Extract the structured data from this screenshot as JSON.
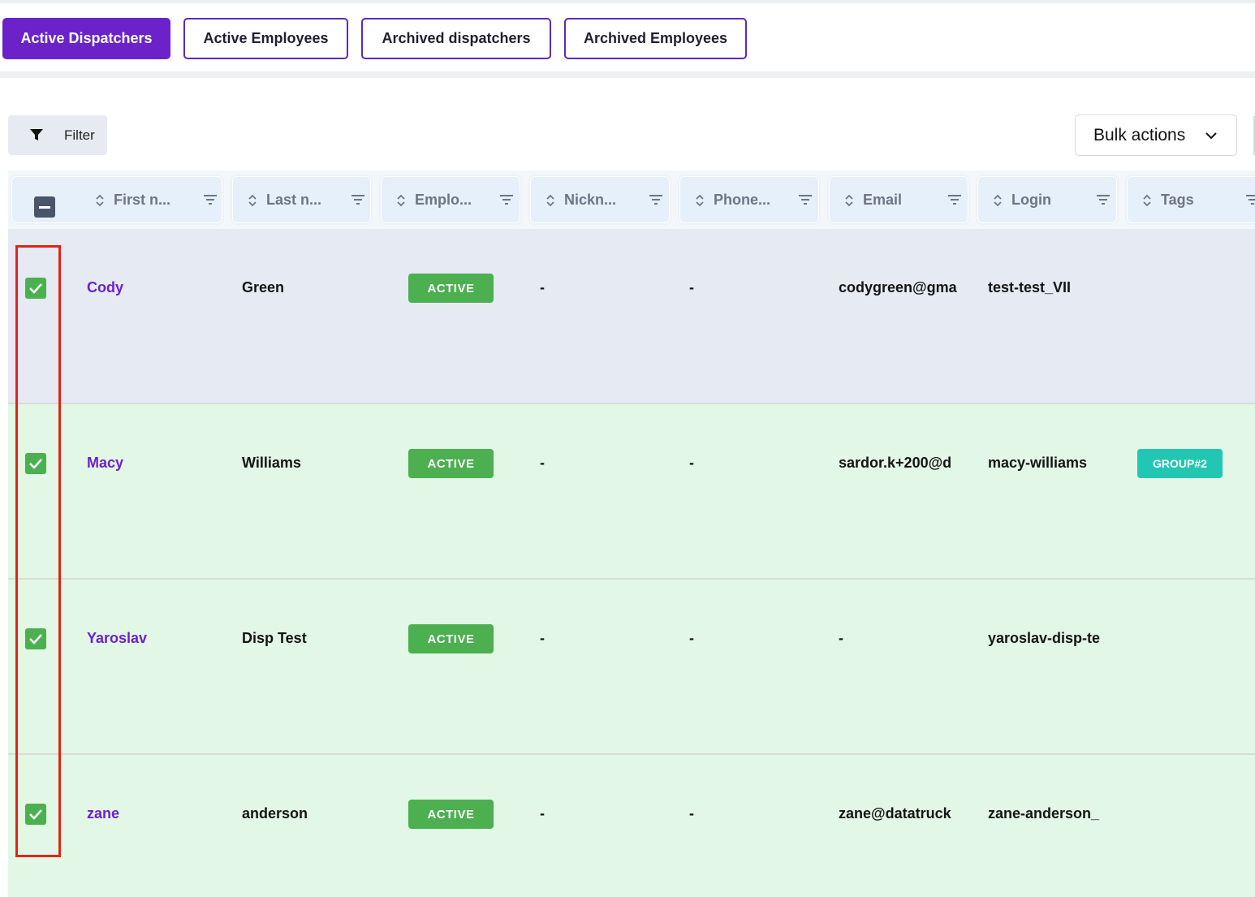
{
  "tabs": [
    {
      "label": "Active Dispatchers",
      "active": true
    },
    {
      "label": "Active Employees",
      "active": false
    },
    {
      "label": "Archived dispatchers",
      "active": false
    },
    {
      "label": "Archived Employees",
      "active": false
    }
  ],
  "toolbar": {
    "filter_label": "Filter",
    "bulk_actions_label": "Bulk actions"
  },
  "table": {
    "columns": [
      "First n...",
      "Last n...",
      "Emplo...",
      "Nickn...",
      "Phone...",
      "Email",
      "Login",
      "Tags"
    ],
    "rows": [
      {
        "first": "Cody",
        "last": "Green",
        "status": "ACTIVE",
        "nickname": "-",
        "phone": "-",
        "email": "codygreen@gma",
        "login": "test-test_VII",
        "tag": "",
        "checked": true
      },
      {
        "first": "Macy",
        "last": "Williams",
        "status": "ACTIVE",
        "nickname": "-",
        "phone": "-",
        "email": "sardor.k+200@d",
        "login": "macy-williams",
        "tag": "GROUP#2",
        "checked": true
      },
      {
        "first": "Yaroslav",
        "last": "Disp Test",
        "status": "ACTIVE",
        "nickname": "-",
        "phone": "-",
        "email": "-",
        "login": "yaroslav-disp-te",
        "tag": "",
        "checked": true
      },
      {
        "first": "zane",
        "last": "anderson",
        "status": "ACTIVE",
        "nickname": "-",
        "phone": "-",
        "email": "zane@datatruck",
        "login": "zane-anderson_",
        "tag": "",
        "checked": true
      }
    ]
  },
  "colors": {
    "accent": "#6b22c9",
    "active_badge": "#4caf50",
    "tag_badge": "#22c7b3",
    "selected_row": "#e2f7e5",
    "highlight_box": "#e0241b"
  },
  "icons": [
    "filter-funnel-icon",
    "chevron-down-icon",
    "sort-icon",
    "column-filter-icon",
    "checkmark-icon"
  ]
}
